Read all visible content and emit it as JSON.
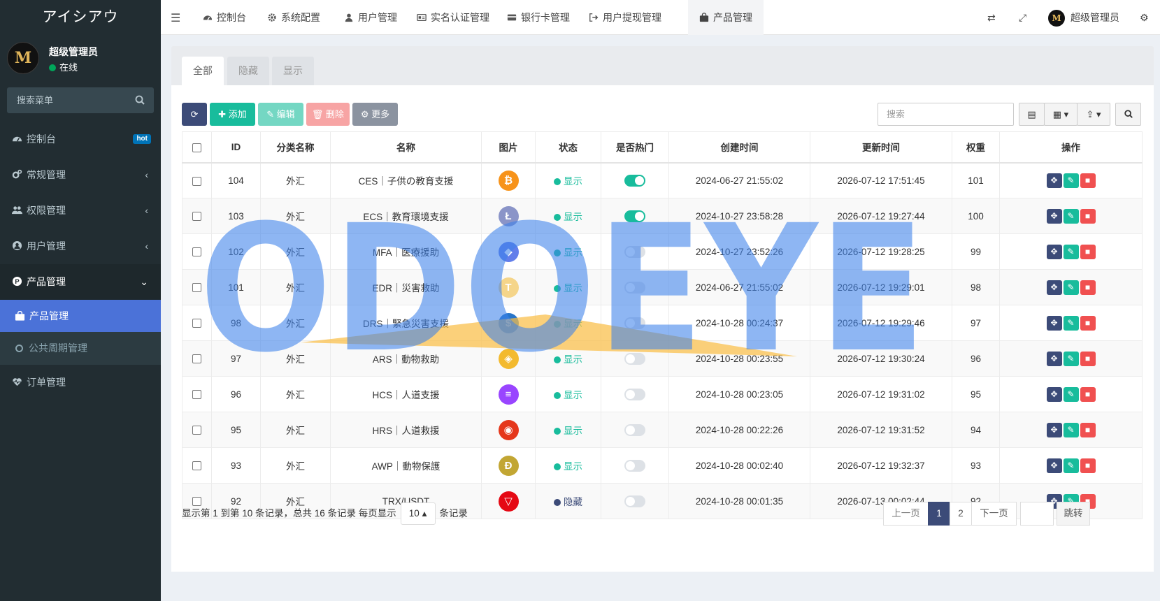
{
  "sidebar": {
    "logo": "アイシアウ",
    "user": {
      "avatar_text": "M",
      "name": "超级管理员",
      "status": "在线"
    },
    "search_placeholder": "搜索菜单",
    "menu": [
      {
        "label": "控制台",
        "badge": "hot"
      },
      {
        "label": "常规管理"
      },
      {
        "label": "权限管理"
      },
      {
        "label": "用户管理"
      },
      {
        "label": "产品管理"
      }
    ],
    "submenu": [
      {
        "label": "产品管理"
      },
      {
        "label": "公共周期管理"
      }
    ],
    "menu_after": {
      "label": "订单管理"
    }
  },
  "topbar": {
    "tabs": [
      {
        "label": "控制台"
      },
      {
        "label": "系统配置"
      },
      {
        "label": "用户管理"
      },
      {
        "label": "实名认证管理"
      },
      {
        "label": "银行卡管理"
      },
      {
        "label": "用户提现管理"
      },
      {
        "label": "产品管理"
      }
    ],
    "user": {
      "avatar_text": "M",
      "name": "超级管理员"
    }
  },
  "page_tabs": [
    "全部",
    "隐藏",
    "显示"
  ],
  "toolbar": {
    "add": "添加",
    "edit": "编辑",
    "delete": "删除",
    "more": "更多",
    "search_placeholder": "搜索"
  },
  "table": {
    "headers": [
      "ID",
      "分类名称",
      "名称",
      "图片",
      "状态",
      "是否热门",
      "创建时间",
      "更新时间",
      "权重",
      "操作"
    ],
    "rows": [
      {
        "id": "104",
        "category": "外汇",
        "name": "CES｜子供の教育支援",
        "coin": "bitcoin-icon",
        "coin_color": "#f7931a",
        "coin_glyph": "₿",
        "status": "显示",
        "status_color": "#18bc9c",
        "hot": true,
        "created": "2024-06-27 21:55:02",
        "updated": "2026-07-12 17:51:45",
        "weight": "101"
      },
      {
        "id": "103",
        "category": "外汇",
        "name": "ECS｜教育環境支援",
        "coin": "litecoin-icon",
        "coin_color": "#8a94c8",
        "coin_glyph": "Ł",
        "status": "显示",
        "status_color": "#18bc9c",
        "hot": true,
        "created": "2024-10-27 23:58:28",
        "updated": "2026-07-12 19:27:44",
        "weight": "100"
      },
      {
        "id": "102",
        "category": "外汇",
        "name": "MFA｜医療援助",
        "coin": "ethereum-icon",
        "coin_color": "#627eea",
        "coin_glyph": "◆",
        "status": "显示",
        "status_color": "#18bc9c",
        "hot": false,
        "created": "2024-10-27 23:52:26",
        "updated": "2026-07-12 19:28:25",
        "weight": "99"
      },
      {
        "id": "101",
        "category": "外汇",
        "name": "EDR｜災害救助",
        "coin": "tether-gold-icon",
        "coin_color": "#f5d58a",
        "coin_glyph": "T",
        "status": "显示",
        "status_color": "#18bc9c",
        "hot": false,
        "created": "2024-06-27 21:55:02",
        "updated": "2026-07-12 19:29:01",
        "weight": "98"
      },
      {
        "id": "98",
        "category": "外汇",
        "name": "DRS｜緊急災害支援",
        "coin": "usdc-icon",
        "coin_color": "#2775ca",
        "coin_glyph": "$",
        "status": "显示",
        "status_color": "#18bc9c",
        "hot": false,
        "created": "2024-10-28 00:24:37",
        "updated": "2026-07-12 19:29:46",
        "weight": "97"
      },
      {
        "id": "97",
        "category": "外汇",
        "name": "ARS｜動物救助",
        "coin": "binance-icon",
        "coin_color": "#f3ba2f",
        "coin_glyph": "◈",
        "status": "显示",
        "status_color": "#18bc9c",
        "hot": false,
        "created": "2024-10-28 00:23:55",
        "updated": "2026-07-12 19:30:24",
        "weight": "96"
      },
      {
        "id": "96",
        "category": "外汇",
        "name": "HCS｜人道支援",
        "coin": "solana-icon",
        "coin_color": "#9945ff",
        "coin_glyph": "≡",
        "status": "显示",
        "status_color": "#18bc9c",
        "hot": false,
        "created": "2024-10-28 00:23:05",
        "updated": "2026-07-12 19:31:02",
        "weight": "95"
      },
      {
        "id": "95",
        "category": "外汇",
        "name": "HRS｜人道救援",
        "coin": "shiba-icon",
        "coin_color": "#e5371b",
        "coin_glyph": "◉",
        "status": "显示",
        "status_color": "#18bc9c",
        "hot": false,
        "created": "2024-10-28 00:22:26",
        "updated": "2026-07-12 19:31:52",
        "weight": "94"
      },
      {
        "id": "93",
        "category": "外汇",
        "name": "AWP｜動物保護",
        "coin": "dogecoin-icon",
        "coin_color": "#c2a633",
        "coin_glyph": "Ð",
        "status": "显示",
        "status_color": "#18bc9c",
        "hot": false,
        "created": "2024-10-28 00:02:40",
        "updated": "2026-07-12 19:32:37",
        "weight": "93"
      },
      {
        "id": "92",
        "category": "外汇",
        "name": "TRX/USDT",
        "coin": "tron-icon",
        "coin_color": "#e50914",
        "coin_glyph": "▽",
        "status": "隐藏",
        "status_color": "#3c4b78",
        "hot": false,
        "created": "2024-10-28 00:01:35",
        "updated": "2026-07-13 00:02:44",
        "weight": "92"
      }
    ]
  },
  "footer": {
    "prefix": "显示第 1 到第 10 条记录，总共 16 条记录 每页显示",
    "per_page": "10",
    "suffix": "条记录"
  },
  "pager": {
    "prev": "上一页",
    "pages": [
      "1",
      "2"
    ],
    "next": "下一页",
    "jump": "跳转"
  },
  "watermark": "ODOEYE",
  "colors": {
    "sidebar": "#222d32",
    "active_menu": "#4b72d8",
    "success": "#18bc9c",
    "danger": "#f05050",
    "primary_dark": "#3c4b78"
  }
}
